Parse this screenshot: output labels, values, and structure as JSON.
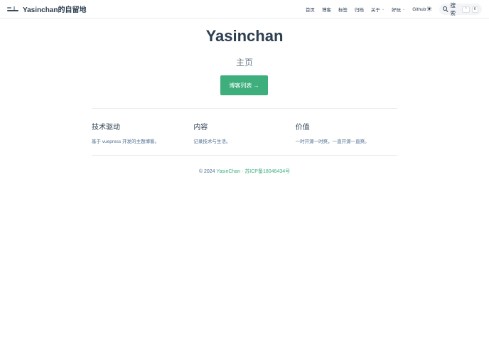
{
  "navbar": {
    "site_name": "Yasinchan的自留地",
    "items": [
      {
        "label": "首页",
        "dropdown": false,
        "external": false
      },
      {
        "label": "博客",
        "dropdown": false,
        "external": false
      },
      {
        "label": "标签",
        "dropdown": false,
        "external": false
      },
      {
        "label": "归档",
        "dropdown": false,
        "external": false
      },
      {
        "label": "关于",
        "dropdown": true,
        "external": false
      },
      {
        "label": "好玩",
        "dropdown": true,
        "external": false
      },
      {
        "label": "Github",
        "dropdown": false,
        "external": true
      }
    ],
    "search_label": "搜索",
    "search_shortcut_1": "⌃",
    "search_shortcut_2": "K"
  },
  "hero": {
    "title": "Yasinchan",
    "subtitle": "主页",
    "cta_label": "博客列表 →"
  },
  "features": [
    {
      "title": "技术驱动",
      "description": "基于 vuepress 开发的主题博客。"
    },
    {
      "title": "内容",
      "description": "记录技术与生活。"
    },
    {
      "title": "价值",
      "description": "一时开源一时爽，一直开源一直爽。"
    }
  ],
  "footer": {
    "copyright": "© 2024 ",
    "author_link": "YasinChan",
    "separator": " · ",
    "icp_link": "苏ICP备18046434号"
  },
  "colors": {
    "accent": "#3eaf7c",
    "text": "#2c3e50",
    "divider": "#eaecef"
  },
  "icons": {
    "theme_toggle": "sun-icon",
    "search": "search-icon",
    "external": "external-link-icon",
    "dropdown": "chevron-down-icon"
  }
}
